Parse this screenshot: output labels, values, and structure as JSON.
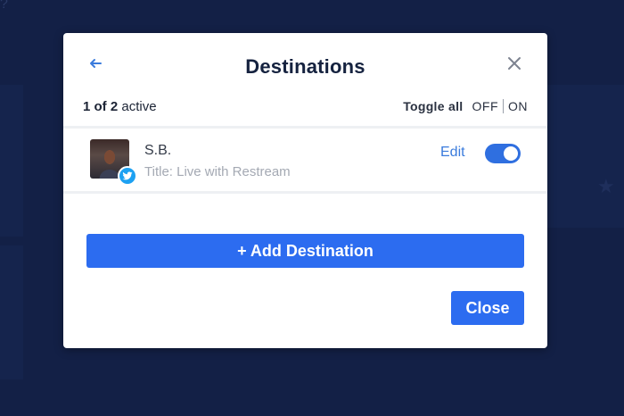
{
  "modal": {
    "title": "Destinations",
    "back_icon": "arrow-left-icon",
    "close_icon": "close-icon",
    "active": {
      "count": "1 of 2",
      "suffix": " active"
    },
    "toggle_all": {
      "label": "Toggle all",
      "off": "OFF",
      "on": "ON"
    },
    "destinations": [
      {
        "name": "S.B.",
        "subtitle": "Title: Live with Restream",
        "platform_icon": "twitter-icon",
        "edit_label": "Edit",
        "enabled": true
      }
    ],
    "add_button": "+ Add Destination",
    "close_button": "Close"
  },
  "colors": {
    "accent": "#2c6cf0",
    "link": "#3a7bdc",
    "title": "#15223f",
    "background": "#132046",
    "twitter": "#1da1f2"
  }
}
